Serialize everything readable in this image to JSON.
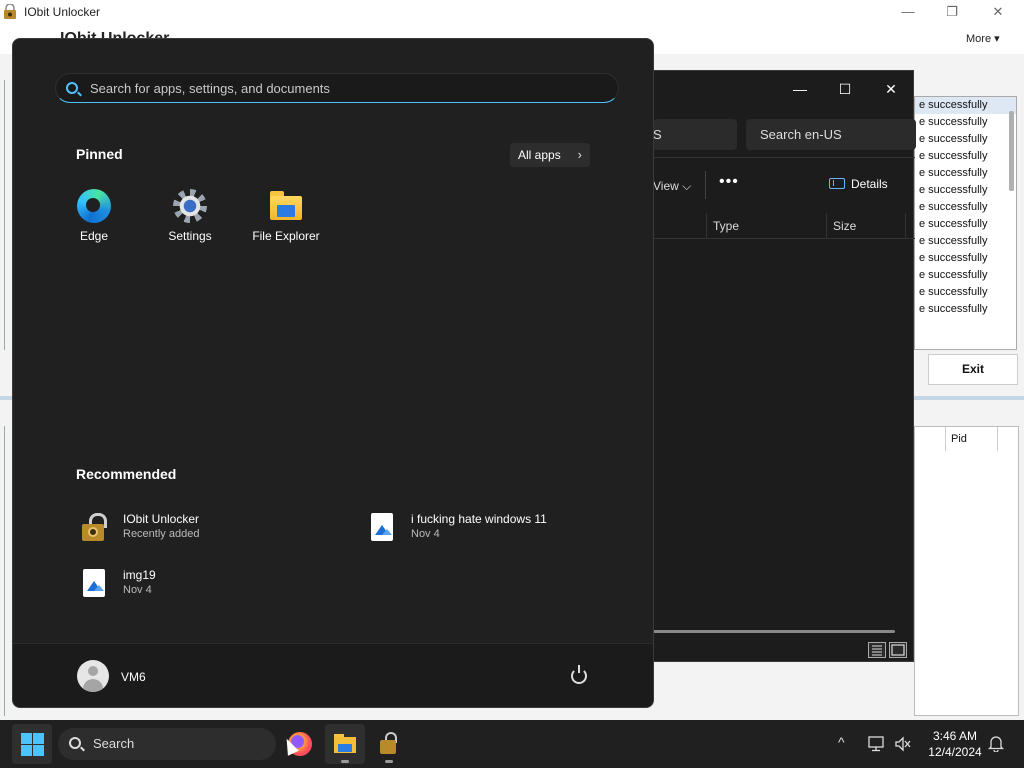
{
  "iobit": {
    "window_title": "IObit Unlocker",
    "header_title": "IObit Unlocker",
    "more_label": "More ▾",
    "status_rows": [
      "e successfully",
      "e successfully",
      "e successfully",
      "e successfully",
      "e successfully",
      "e successfully",
      "e successfully",
      "e successfully",
      "e successfully",
      "e successfully",
      "e successfully",
      "e successfully",
      "e successfully"
    ],
    "exit_label": "Exit",
    "pid_header": "Pid",
    "window_controls": {
      "minimize": "—",
      "maximize": "❐",
      "close": "✕"
    }
  },
  "explorer": {
    "window_controls": {
      "minimize": "—",
      "maximize": "☐",
      "close": "✕"
    },
    "address_fragment": "S",
    "search_placeholder": "Search en-US",
    "view_label": "View ⌵",
    "more_dots": "•••",
    "details_label": "Details",
    "columns": [
      "Type",
      "Size"
    ]
  },
  "start_menu": {
    "search_placeholder": "Search for apps, settings, and documents",
    "pinned_heading": "Pinned",
    "all_apps_label": "All apps",
    "all_apps_chevron": "›",
    "pinned_apps": [
      {
        "label": "Edge",
        "icon": "edge-icon"
      },
      {
        "label": "Settings",
        "icon": "settings-gear-icon"
      },
      {
        "label": "File Explorer",
        "icon": "file-explorer-folder-icon"
      }
    ],
    "recommended_heading": "Recommended",
    "recommended": [
      {
        "name": "IObit Unlocker",
        "sub": "Recently added",
        "icon": "iobit-lock-icon"
      },
      {
        "name": "i fucking hate windows 11",
        "sub": "Nov 4",
        "icon": "image-file-icon"
      },
      {
        "name": "img19",
        "sub": "Nov 4",
        "icon": "image-file-icon"
      }
    ],
    "user_name": "VM6",
    "power_icon": "power-icon"
  },
  "taskbar": {
    "search_label": "Search",
    "apps": [
      "firefox-icon",
      "file-explorer-icon",
      "iobit-unlocker-icon"
    ],
    "tray": {
      "chevron": "^",
      "time": "3:46 AM",
      "date": "12/4/2024"
    },
    "accent": "#4cc2ff"
  }
}
